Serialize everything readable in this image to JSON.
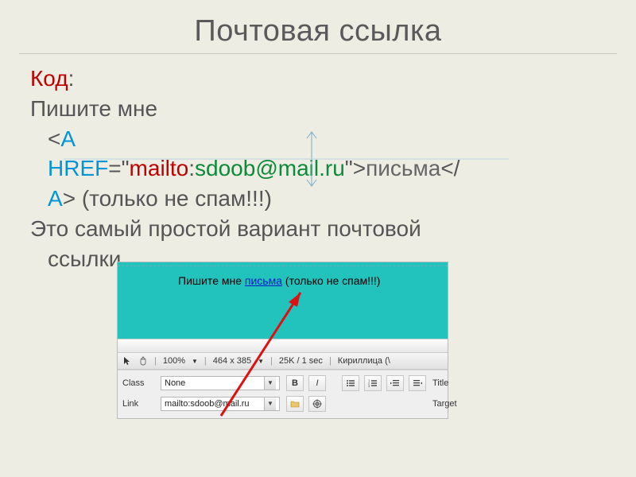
{
  "title": "Почтовая ссылка",
  "code_label": "Код",
  "code_label_colon": ":",
  "line1": "Пишите мне",
  "mailto_scheme": "mailto",
  "email_user": "sdoob",
  "email_at": "@",
  "email_domain": "mail.ru",
  "link_inner": "письма",
  "after_link": " (только не спам!!!)",
  "desc_line1": "Это самый простой вариант почтовой",
  "desc_line2": "ссылки.",
  "tag_open": "<",
  "tag_a": "A",
  "attr_href": "HREF",
  "eq": "=",
  "q": "\"",
  "colon": ":",
  "tag_close": ">",
  "close_tag_open": "</",
  "close_tag_a": "A",
  "shot": {
    "page_text_before": "Пишите мне ",
    "page_link": "письма",
    "page_text_after": " (только не спам!!!)",
    "status_zoom": "100%",
    "status_size": "464 x 385",
    "status_weight": "25K / 1 sec",
    "status_enc": "Кириллица (\\",
    "panel_class_label": "Class",
    "panel_class_value": "None",
    "panel_link_label": "Link",
    "panel_link_value": "mailto:sdoob@mail.ru",
    "panel_title_label": "Title",
    "panel_target_label": "Target",
    "btn_bold": "B",
    "btn_italic": "I"
  }
}
